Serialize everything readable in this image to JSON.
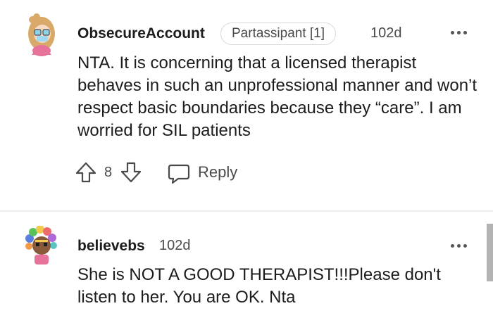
{
  "comments": [
    {
      "username": "ObsecureAccount",
      "flair": "Partassipant [1]",
      "time": "102d",
      "avatar_icon": "avatar-girl-glasses-icon",
      "body": "NTA. It is concerning that a licensed therapist behaves in such an unprofessional manner and won’t respect basic boundaries because they “care”. I am worried for SIL patients",
      "vote_count": "8",
      "reply_label": "Reply"
    },
    {
      "username": "believebs",
      "time": "102d",
      "avatar_icon": "avatar-colorful-hair-icon",
      "body": "She is NOT A GOOD THERAPIST!!!Please don't listen to her. You are OK. Nta"
    }
  ],
  "colors": {
    "text_primary": "#1c1c1c",
    "text_secondary": "#4a4a4a",
    "divider": "#edeff1",
    "flair_border": "#d7dadc"
  }
}
